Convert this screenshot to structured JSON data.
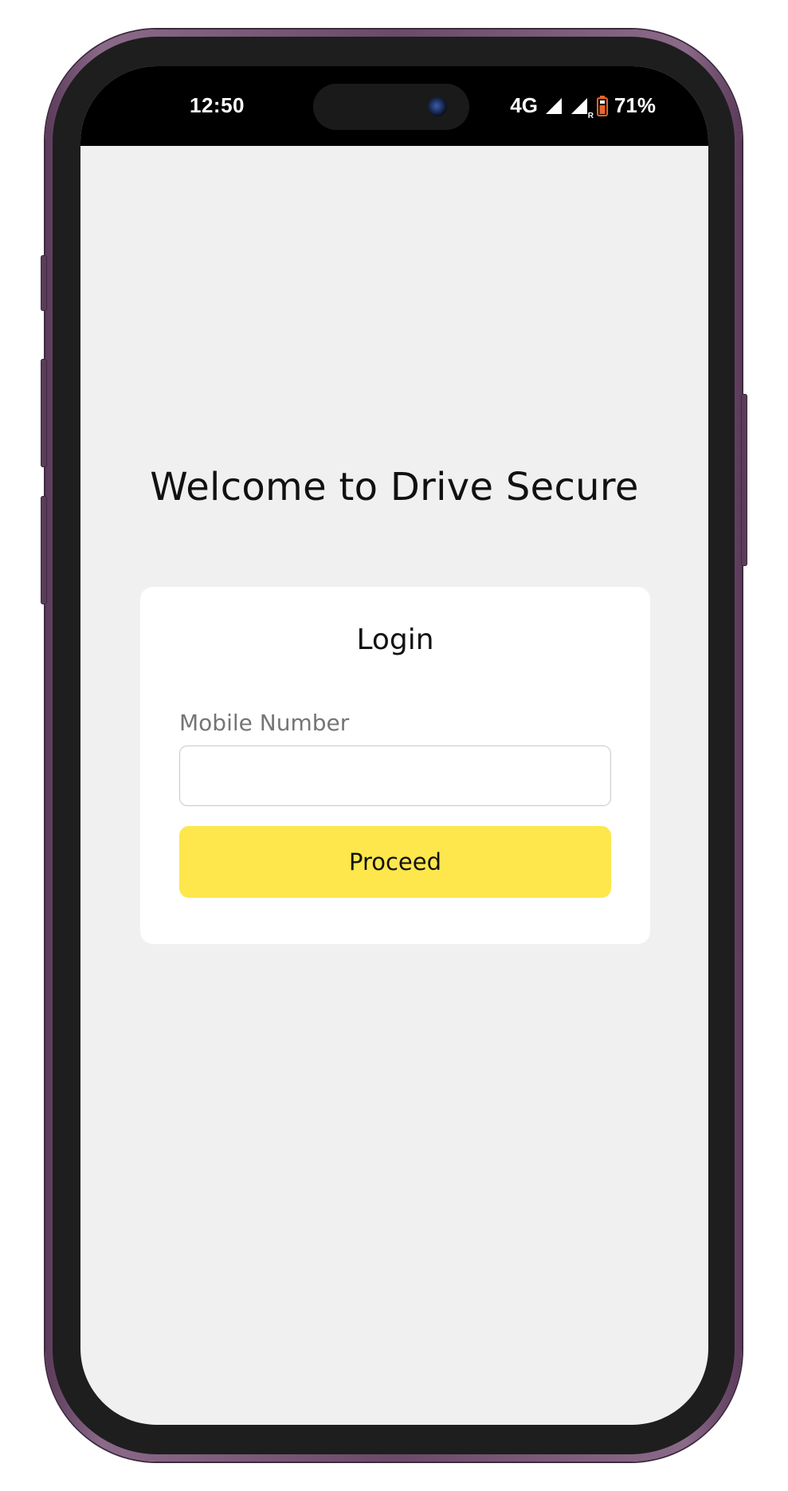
{
  "status_bar": {
    "time": "12:50",
    "network": "4G",
    "roaming_indicator": "R",
    "battery_percent": "71%",
    "icons": [
      "signal-icon",
      "signal-roaming-icon",
      "battery-icon"
    ],
    "battery_color": "#e8652a"
  },
  "main": {
    "welcome_title": "Welcome to Drive Secure"
  },
  "login_card": {
    "heading": "Login",
    "mobile_label": "Mobile Number",
    "mobile_value": "",
    "mobile_placeholder": "",
    "proceed_label": "Proceed"
  },
  "colors": {
    "background": "#f0f0f0",
    "card": "#ffffff",
    "accent": "#fde74c",
    "frame": "#6b4a69"
  }
}
